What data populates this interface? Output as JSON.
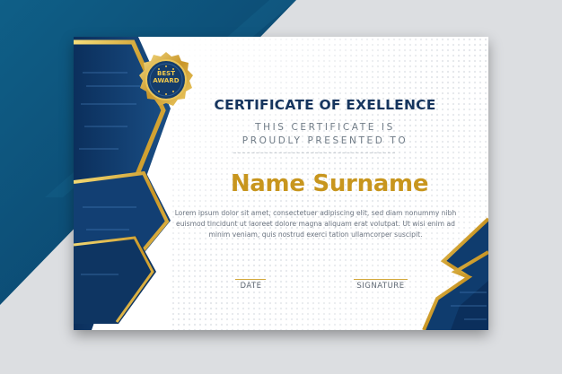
{
  "certificate": {
    "seal_line1": "BEST",
    "seal_line2": "AWARD",
    "title": "CERTIFICATE OF EXELLENCE",
    "subtitle_line1": "THIS CERTIFICATE IS",
    "subtitle_line2": "PROUDLY PRESENTED TO",
    "recipient": "Name Surname",
    "body_line1": "Lorem ipsum dolor sit amet, consectetuer adipiscing elit, sed diam nonummy nibh",
    "body_line2": "euismod tincidunt ut laoreet dolore magna aliquam erat volutpat. Ut wisi enim ad",
    "body_line3": "minim veniam, quis nostrud exerci tation ullamcorper suscipit.",
    "date_label": "DATE",
    "signature_label": "SIGNATURE"
  },
  "colors": {
    "navy": "#0f3c6e",
    "teal": "#0d6e8f",
    "gold": "#d4a93a",
    "name_gold": "#c8961e",
    "background": "#d9dbde"
  },
  "icons": {
    "seal": "award-seal-icon"
  }
}
